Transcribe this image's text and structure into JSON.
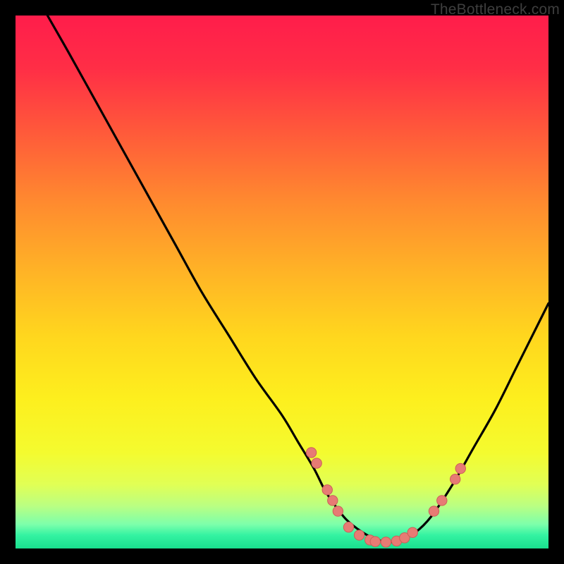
{
  "watermark": "TheBottleneck.com",
  "colors": {
    "background": "#000000",
    "curve": "#000000",
    "dot_fill": "#e77b74",
    "dot_stroke": "#cc5f59"
  },
  "chart_data": {
    "type": "line",
    "title": "",
    "xlabel": "",
    "ylabel": "",
    "xlim": [
      0,
      100
    ],
    "ylim": [
      0,
      100
    ],
    "grid": false,
    "series": [
      {
        "name": "bottleneck-curve",
        "x": [
          6,
          10,
          15,
          20,
          25,
          30,
          35,
          40,
          45,
          50,
          53,
          56,
          58,
          60,
          62,
          64,
          66,
          68,
          70,
          72,
          75,
          78,
          82,
          86,
          90,
          94,
          98,
          100
        ],
        "y": [
          100,
          93,
          84,
          75,
          66,
          57,
          48,
          40,
          32,
          25,
          20,
          15,
          11,
          8,
          5.5,
          3.8,
          2.5,
          1.6,
          1.2,
          1.5,
          3,
          6,
          12,
          19,
          26,
          34,
          42,
          46
        ]
      }
    ],
    "highlight_points": [
      {
        "x": 55.5,
        "y": 18
      },
      {
        "x": 56.5,
        "y": 16
      },
      {
        "x": 58.5,
        "y": 11
      },
      {
        "x": 59.5,
        "y": 9
      },
      {
        "x": 60.5,
        "y": 7
      },
      {
        "x": 62.5,
        "y": 4
      },
      {
        "x": 64.5,
        "y": 2.5
      },
      {
        "x": 66.5,
        "y": 1.6
      },
      {
        "x": 67.5,
        "y": 1.3
      },
      {
        "x": 69.5,
        "y": 1.2
      },
      {
        "x": 71.5,
        "y": 1.4
      },
      {
        "x": 73,
        "y": 2
      },
      {
        "x": 74.5,
        "y": 3
      },
      {
        "x": 78.5,
        "y": 7
      },
      {
        "x": 80,
        "y": 9
      },
      {
        "x": 82.5,
        "y": 13
      },
      {
        "x": 83.5,
        "y": 15
      }
    ],
    "gradient_stops": [
      {
        "offset": 0.0,
        "color": "#ff1d4b"
      },
      {
        "offset": 0.1,
        "color": "#ff2e46"
      },
      {
        "offset": 0.22,
        "color": "#ff5a3a"
      },
      {
        "offset": 0.35,
        "color": "#ff8a2f"
      },
      {
        "offset": 0.48,
        "color": "#ffb326"
      },
      {
        "offset": 0.6,
        "color": "#ffd61e"
      },
      {
        "offset": 0.72,
        "color": "#fdef1e"
      },
      {
        "offset": 0.82,
        "color": "#f4fb2f"
      },
      {
        "offset": 0.88,
        "color": "#e1ff55"
      },
      {
        "offset": 0.92,
        "color": "#baff82"
      },
      {
        "offset": 0.955,
        "color": "#7cffab"
      },
      {
        "offset": 0.975,
        "color": "#34f3a2"
      },
      {
        "offset": 1.0,
        "color": "#19df8e"
      }
    ]
  }
}
